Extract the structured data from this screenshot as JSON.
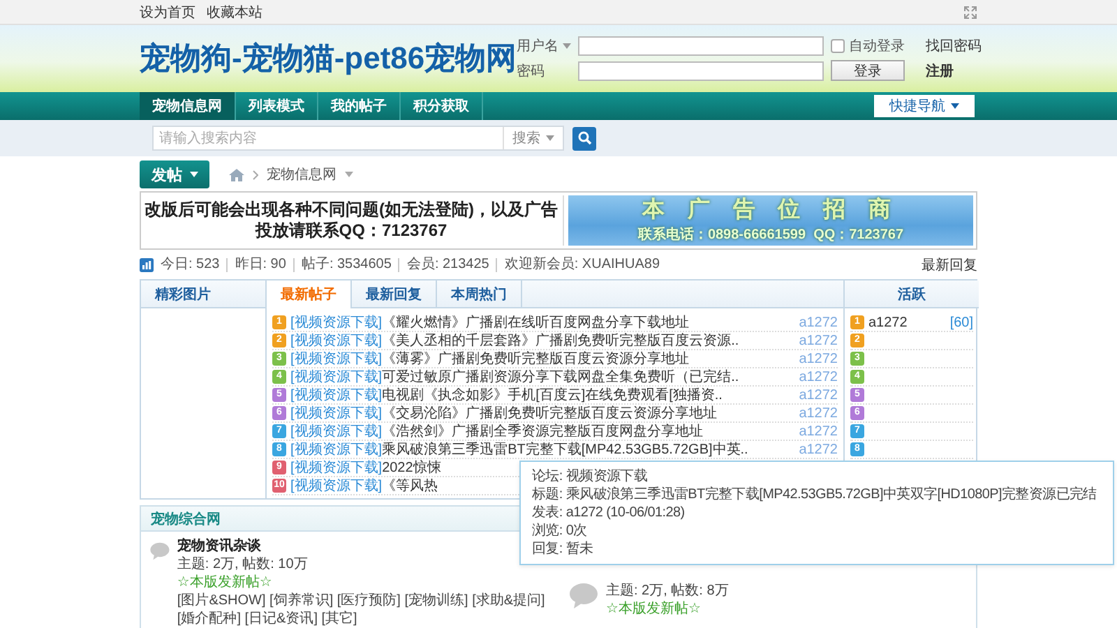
{
  "top_links": [
    "设为首页",
    "收藏本站"
  ],
  "site_title": "宠物狗-宠物猫-pet86宠物网",
  "login": {
    "username_label": "用户名",
    "password_label": "密码",
    "auto_login": {
      "label": "自动登录",
      "checked": false
    },
    "forgot_link": "找回密码",
    "login_button": "登录",
    "register_link": "注册"
  },
  "nav": {
    "items": [
      {
        "label": "宠物信息网",
        "selected": true
      },
      {
        "label": "列表模式",
        "selected": false
      },
      {
        "label": "我的帖子",
        "selected": false
      },
      {
        "label": "积分获取",
        "selected": false
      }
    ],
    "quick_nav": "快捷导航"
  },
  "search": {
    "placeholder": "请输入搜索内容",
    "type_label": "搜索"
  },
  "post_button": "发帖",
  "breadcrumb": "宠物信息网",
  "notice": "改版后可能会出现各种不同问题(如无法登陆)，以及广告投放请联系QQ：7123767",
  "ad_banner": {
    "headline": "本 广 告 位 招 商",
    "contact": "联系电话：0898-66661599  QQ：7123767"
  },
  "stats": [
    "今日: 523",
    "昨日: 90",
    "帖子: 3534605",
    "会员: 213425",
    "欢迎新会员: XUAIHUA89"
  ],
  "latest_replies_link": "最新回复",
  "panel": {
    "photos_title": "精彩图片",
    "tabs": [
      {
        "label": "最新帖子",
        "selected": true
      },
      {
        "label": "最新回复",
        "selected": false
      },
      {
        "label": "本周热门",
        "selected": false
      }
    ],
    "posts": [
      {
        "rank": "1",
        "color": "#f0a020",
        "forum": "[视频资源下载]",
        "title": "《耀火燃情》广播剧在线听百度网盘分享下载地址",
        "author": "a1272"
      },
      {
        "rank": "2",
        "color": "#f0a020",
        "forum": "[视频资源下载]",
        "title": "《美人丞相的千层套路》广播剧免费听完整版百度云资源..",
        "author": "a1272"
      },
      {
        "rank": "3",
        "color": "#7cc04a",
        "forum": "[视频资源下载]",
        "title": "《薄雾》广播剧免费听完整版百度云资源分享地址",
        "author": "a1272"
      },
      {
        "rank": "4",
        "color": "#7cc04a",
        "forum": "[视频资源下载]",
        "title": "可爱过敏原广播剧资源分享下载网盘全集免费听（已完结..",
        "author": "a1272"
      },
      {
        "rank": "5",
        "color": "#b07ad8",
        "forum": "[视频资源下载]",
        "title": "电视剧《执念如影》手机[百度云]在线免费观看[独播资..",
        "author": "a1272"
      },
      {
        "rank": "6",
        "color": "#b07ad8",
        "forum": "[视频资源下载]",
        "title": "《交易沦陷》广播剧免费听完整版百度云资源分享地址",
        "author": "a1272"
      },
      {
        "rank": "7",
        "color": "#3aa6e0",
        "forum": "[视频资源下载]",
        "title": "《浩然剑》广播剧全季资源完整版百度网盘分享地址",
        "author": "a1272"
      },
      {
        "rank": "8",
        "color": "#3aa6e0",
        "forum": "[视频资源下载]",
        "title": "乘风破浪第三季迅雷BT完整下载[MP42.53GB5.72GB]中英..",
        "author": "a1272"
      },
      {
        "rank": "9",
        "color": "#e06070",
        "forum": "[视频资源下载]",
        "title": "2022惊悚"
      },
      {
        "rank": "10",
        "color": "#e06070",
        "forum": "[视频资源下载]",
        "title": "《等风热"
      }
    ],
    "active_title": "活跃",
    "active_users": [
      {
        "rank": "1",
        "color": "#f0a020",
        "name": "a1272",
        "count": "[60]"
      },
      {
        "rank": "2",
        "color": "#f0a020"
      },
      {
        "rank": "3",
        "color": "#7cc04a"
      },
      {
        "rank": "4",
        "color": "#7cc04a"
      },
      {
        "rank": "5",
        "color": "#b07ad8"
      },
      {
        "rank": "6",
        "color": "#b07ad8"
      },
      {
        "rank": "7",
        "color": "#3aa6e0"
      },
      {
        "rank": "8",
        "color": "#3aa6e0"
      }
    ]
  },
  "forum_group": {
    "title": "宠物综合网",
    "forums": [
      {
        "name": "宠物资讯杂谈",
        "stats": "主题: 2万, 帖数: 10万",
        "new_post_link": "☆本版发新帖☆",
        "subforums": [
          "[图片&SHOW]",
          "[饲养常识]",
          "[医疗预防]",
          "[宠物训练]",
          "[求助&提问]",
          "[婚介配种]",
          "[日记&资讯]",
          "[其它]"
        ]
      },
      {
        "stats": "主题: 2万, 帖数: 8万",
        "new_post_link": "☆本版发新帖☆"
      }
    ]
  },
  "tooltip": {
    "lines": [
      "论坛: 视频资源下载",
      "标题: 乘风破浪第三季迅雷BT完整下载[MP42.53GB5.72GB]中英双字[HD1080P]完整资源已完结",
      "发表: a1272 (10-06/01:28)",
      "浏览: 0次",
      "回复: 暂未"
    ]
  }
}
